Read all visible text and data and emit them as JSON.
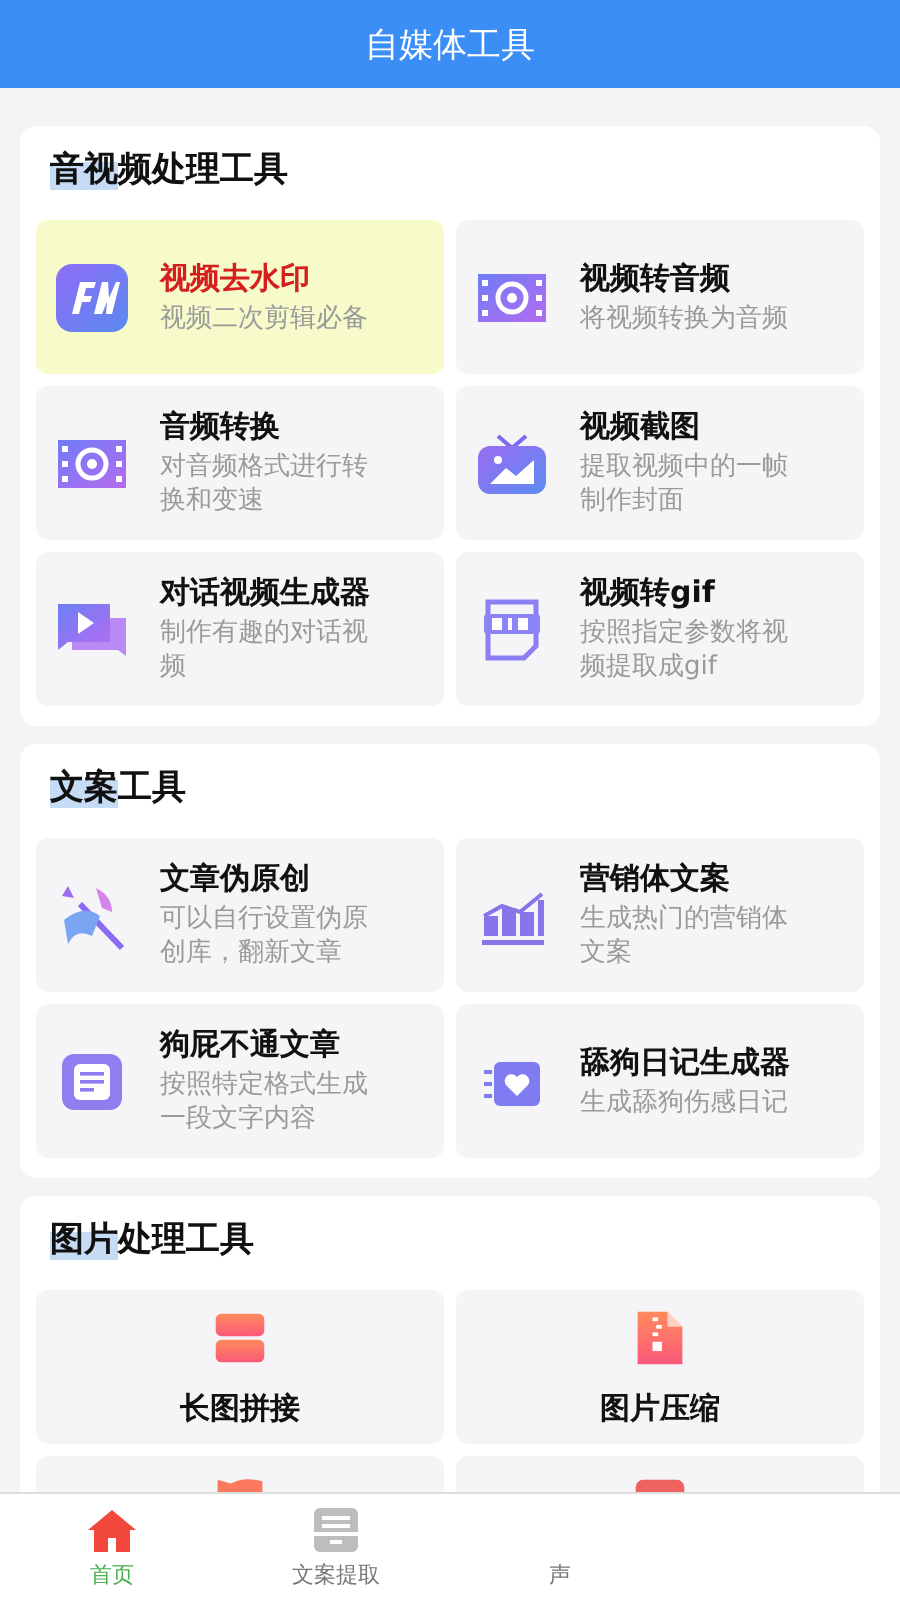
{
  "header": {
    "title": "自媒体工具"
  },
  "sections": [
    {
      "title_highlight": "音视",
      "title_rest": "频处理工具",
      "kind": "list",
      "tools": [
        {
          "kind": "film-f",
          "title": "视频去水印",
          "subtitle": "视频二次剪辑必备",
          "selected": true
        },
        {
          "kind": "film-loop",
          "title": "视频转音频",
          "subtitle": "将视频转换为音频",
          "selected": false
        },
        {
          "kind": "film-loop",
          "title": "音频转换",
          "subtitle": "对音频格式进行转换和变速",
          "selected": false
        },
        {
          "kind": "tv",
          "title": "视频截图",
          "subtitle": "提取视频中的一帧制作封面",
          "selected": false
        },
        {
          "kind": "chat",
          "title": "对话视频生成器",
          "subtitle": "制作有趣的对话视频",
          "selected": false
        },
        {
          "kind": "gif",
          "title": "视频转gif",
          "subtitle": "按照指定参数将视频提取成gif",
          "selected": false
        }
      ]
    },
    {
      "title_highlight": "文案",
      "title_rest": "工具",
      "kind": "list",
      "tools": [
        {
          "kind": "wand",
          "title": "文章伪原创",
          "subtitle": "可以自行设置伪原创库，翻新文章",
          "selected": false
        },
        {
          "kind": "chart",
          "title": "营销体文案",
          "subtitle": "生成热门的营销体文案",
          "selected": false
        },
        {
          "kind": "note",
          "title": "狗屁不通文章",
          "subtitle": "按照特定格式生成一段文字内容",
          "selected": false
        },
        {
          "kind": "heart",
          "title": "舔狗日记生成器",
          "subtitle": "生成舔狗伤感日记",
          "selected": false
        }
      ]
    },
    {
      "title_highlight": "图片",
      "title_rest": "处理工具",
      "kind": "tiles",
      "tools": [
        {
          "kind": "stack",
          "title": "长图拼接"
        },
        {
          "kind": "zip",
          "title": "图片压缩"
        },
        {
          "kind": "orange-cut"
        },
        {
          "kind": "red-cut"
        }
      ]
    }
  ],
  "tabs": [
    {
      "kind": "home",
      "label": "首页",
      "selected": true
    },
    {
      "kind": "tray",
      "label": "文案提取",
      "selected": false
    },
    {
      "kind": "none",
      "label": "声",
      "selected": false
    }
  ]
}
